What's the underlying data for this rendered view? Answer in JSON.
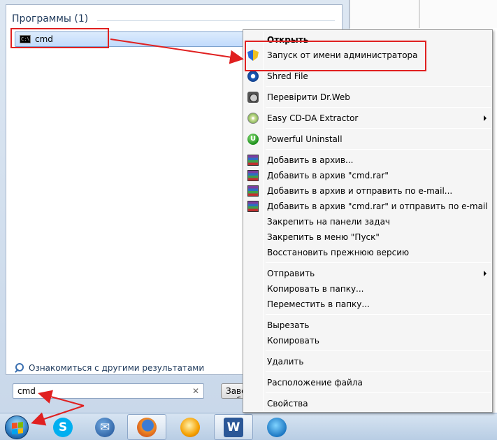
{
  "start_menu": {
    "programs_header": "Программы (1)",
    "program_items": [
      {
        "label": "cmd",
        "icon": "console-icon"
      }
    ],
    "more_results": "Ознакомиться с другими результатами",
    "search": {
      "value": "cmd"
    },
    "shutdown_label": "Завершение работы"
  },
  "context_menu": {
    "items": [
      {
        "label": "Открыть",
        "bold": true
      },
      {
        "label": "Запуск от имени администратора",
        "icon": "uac-shield-icon"
      },
      {
        "label": "Shred File",
        "icon": "shred-file-icon"
      },
      {
        "label": "Перевірити Dr.Web",
        "icon": "drweb-icon"
      },
      {
        "label": "Easy CD-DA Extractor",
        "icon": "cd-icon",
        "submenu": true
      },
      {
        "label": "Powerful Uninstall",
        "icon": "uninstall-icon"
      },
      {
        "label": "Добавить в архив...",
        "icon": "winrar-icon"
      },
      {
        "label": "Добавить в архив \"cmd.rar\"",
        "icon": "winrar-icon"
      },
      {
        "label": "Добавить в архив и отправить по e-mail...",
        "icon": "winrar-icon"
      },
      {
        "label": "Добавить в архив \"cmd.rar\" и отправить по e-mail",
        "icon": "winrar-icon"
      },
      {
        "label": "Закрепить на панели задач"
      },
      {
        "label": "Закрепить в меню \"Пуск\""
      },
      {
        "label": "Восстановить прежнюю версию"
      },
      {
        "label": "Отправить",
        "submenu": true
      },
      {
        "label": "Копировать в папку..."
      },
      {
        "label": "Переместить в папку..."
      },
      {
        "label": "Вырезать"
      },
      {
        "label": "Копировать"
      },
      {
        "label": "Удалить"
      },
      {
        "label": "Расположение файла"
      },
      {
        "label": "Свойства"
      }
    ]
  },
  "taskbar": {
    "items": [
      "start-orb",
      "skype-icon",
      "thunderbird-icon",
      "firefox-icon",
      "media-player-icon",
      "word-icon",
      "app-icon"
    ]
  },
  "colors": {
    "highlight_red": "#e02020",
    "menu_bg": "#f5f5f5",
    "selection_blue": "#c1dbfc"
  }
}
